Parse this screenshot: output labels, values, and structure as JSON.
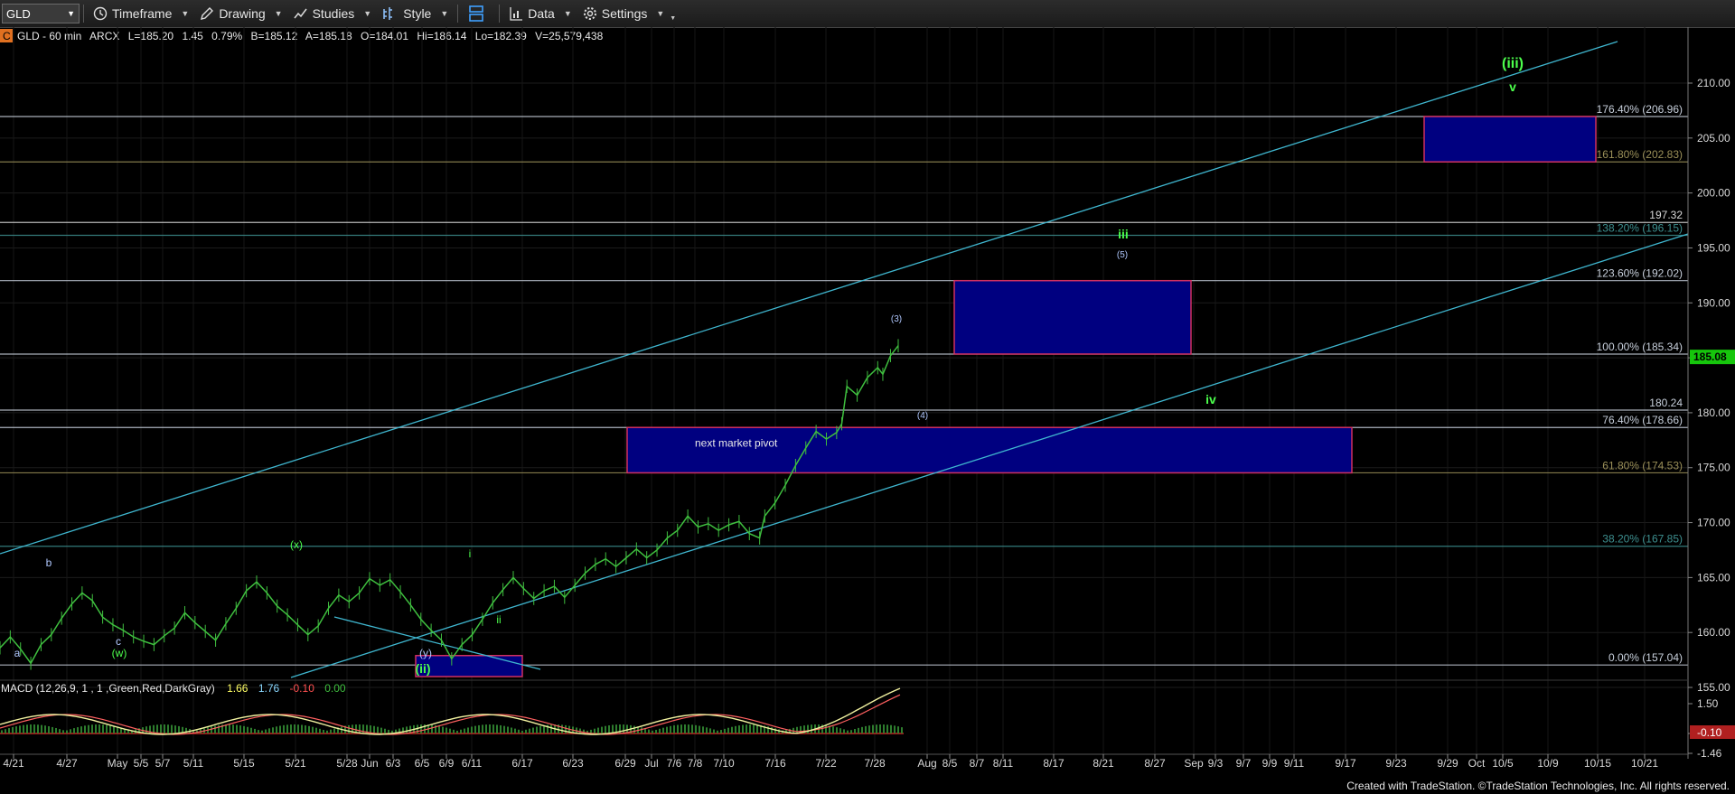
{
  "toolbar": {
    "symbol": "GLD",
    "timeframe": "Timeframe",
    "drawing": "Drawing",
    "studies": "Studies",
    "style": "Style",
    "data": "Data",
    "settings": "Settings"
  },
  "header": {
    "badge": "C",
    "fields": [
      "GLD - 60 min",
      "ARCX",
      "L=185.20",
      "1.45",
      "0.79%",
      "B=185.12",
      "A=185.18",
      "O=184.01",
      "Hi=186.14",
      "Lo=182.39",
      "V=25,579,438"
    ]
  },
  "macd_header": {
    "label": "MACD (12,26,9, 1 , 1 ,Green,Red,DarkGray)",
    "values": [
      "1.66",
      "1.76",
      "-0.10",
      "0.00"
    ],
    "colors": [
      "#ffff66",
      "#8ad8ff",
      "#ff5050",
      "#3fbf3f"
    ]
  },
  "footer": "Created with TradeStation. ©TradeStation Technologies, Inc. All rights reserved.",
  "chart_data": [
    {
      "type": "candlestick",
      "series": [
        {
          "name": "GLD",
          "description": "hourly price path (approximate)",
          "points": [
            [
              0,
              158.6
            ],
            [
              4,
              159.6
            ],
            [
              8,
              158.5
            ],
            [
              12,
              157.2
            ],
            [
              16,
              158.9
            ],
            [
              20,
              159.8
            ],
            [
              24,
              161.3
            ],
            [
              28,
              162.6
            ],
            [
              32,
              163.6
            ],
            [
              36,
              162.9
            ],
            [
              40,
              161.4
            ],
            [
              44,
              160.7
            ],
            [
              48,
              160.2
            ],
            [
              52,
              159.6
            ],
            [
              56,
              159.2
            ],
            [
              60,
              158.9
            ],
            [
              64,
              159.7
            ],
            [
              68,
              160.4
            ],
            [
              72,
              161.8
            ],
            [
              76,
              160.9
            ],
            [
              80,
              160.1
            ],
            [
              84,
              159.3
            ],
            [
              88,
              160.8
            ],
            [
              92,
              162.2
            ],
            [
              96,
              163.8
            ],
            [
              100,
              164.6
            ],
            [
              104,
              163.6
            ],
            [
              108,
              162.4
            ],
            [
              112,
              161.6
            ],
            [
              116,
              160.7
            ],
            [
              120,
              159.8
            ],
            [
              124,
              160.6
            ],
            [
              128,
              162.2
            ],
            [
              132,
              163.4
            ],
            [
              136,
              162.8
            ],
            [
              140,
              163.6
            ],
            [
              144,
              164.9
            ],
            [
              148,
              164.3
            ],
            [
              152,
              164.8
            ],
            [
              156,
              163.7
            ],
            [
              160,
              162.5
            ],
            [
              164,
              161.2
            ],
            [
              168,
              160.2
            ],
            [
              172,
              159.3
            ],
            [
              176,
              157.6
            ],
            [
              180,
              158.9
            ],
            [
              184,
              159.8
            ],
            [
              188,
              161.2
            ],
            [
              192,
              162.7
            ],
            [
              196,
              163.9
            ],
            [
              200,
              165.0
            ],
            [
              204,
              164.0
            ],
            [
              208,
              163.1
            ],
            [
              212,
              163.8
            ],
            [
              216,
              164.2
            ],
            [
              220,
              163.2
            ],
            [
              224,
              164.3
            ],
            [
              228,
              165.4
            ],
            [
              232,
              166.2
            ],
            [
              236,
              166.7
            ],
            [
              240,
              166.0
            ],
            [
              244,
              166.8
            ],
            [
              248,
              167.6
            ],
            [
              252,
              166.8
            ],
            [
              256,
              167.5
            ],
            [
              260,
              168.6
            ],
            [
              264,
              169.3
            ],
            [
              268,
              170.6
            ],
            [
              272,
              169.6
            ],
            [
              276,
              169.9
            ],
            [
              280,
              169.3
            ],
            [
              284,
              169.8
            ],
            [
              288,
              170.1
            ],
            [
              292,
              169.0
            ],
            [
              296,
              168.6
            ],
            [
              298,
              170.6
            ],
            [
              302,
              171.8
            ],
            [
              306,
              173.4
            ],
            [
              310,
              175.2
            ],
            [
              314,
              176.8
            ],
            [
              318,
              178.3
            ],
            [
              322,
              177.6
            ],
            [
              326,
              178.2
            ],
            [
              328,
              179.0
            ],
            [
              330,
              182.4
            ],
            [
              334,
              181.6
            ],
            [
              338,
              183.2
            ],
            [
              342,
              184.1
            ],
            [
              344,
              183.5
            ],
            [
              347,
              185.2
            ],
            [
              350,
              186.1
            ]
          ]
        }
      ],
      "x_tick_labels": [
        "4/21",
        "4/27",
        "May",
        "5/5",
        "5/7",
        "5/11",
        "5/15",
        "5/21",
        "5/28",
        "Jun",
        "6/3",
        "6/5",
        "6/9",
        "6/11",
        "6/17",
        "6/23",
        "6/29",
        "Jul",
        "7/6",
        "7/8",
        "7/10",
        "7/16",
        "7/22",
        "7/28",
        "Aug",
        "8/5",
        "8/7",
        "8/11",
        "8/17",
        "8/21",
        "8/27",
        "Sep",
        "9/3",
        "9/7",
        "9/9",
        "9/11",
        "9/17",
        "9/23",
        "9/29",
        "Oct",
        "10/5",
        "10/9",
        "10/15",
        "10/21"
      ],
      "ylim": [
        153.2,
        214
      ],
      "y_ticks": [
        155,
        160,
        165,
        170,
        175,
        180,
        185,
        190,
        195,
        200,
        205,
        210
      ],
      "y_tick_labels": [
        "155.00",
        "160.00",
        "165.00",
        "170.00",
        "175.00",
        "180.00",
        "185.00",
        "190.00",
        "195.00",
        "200.00",
        "205.00",
        "210.00"
      ],
      "last_price": 185.08,
      "last_price_label": "185.08",
      "fib_levels": [
        {
          "label": "176.40% (206.96)",
          "value": 206.96,
          "color": "#c8d0dc"
        },
        {
          "label": "161.80% (202.83)",
          "value": 202.83,
          "color": "#9a8f58"
        },
        {
          "label": "197.32",
          "value": 197.32,
          "color": "#d8d8d8"
        },
        {
          "label": "138.20% (196.15)",
          "value": 196.15,
          "color": "#3d8f8f"
        },
        {
          "label": "123.60% (192.02)",
          "value": 192.02,
          "color": "#c8d0dc"
        },
        {
          "label": "100.00% (185.34)",
          "value": 185.34,
          "color": "#c8d0dc"
        },
        {
          "label": "180.24",
          "value": 180.24,
          "color": "#c8d0dc"
        },
        {
          "label": "76.40% (178.66)",
          "value": 178.66,
          "color": "#c8d0dc"
        },
        {
          "label": "61.80% (174.53)",
          "value": 174.53,
          "color": "#9a8f58"
        },
        {
          "label": "38.20% (167.85)",
          "value": 167.85,
          "color": "#3d8f8f"
        },
        {
          "label": "0.00% (157.04)",
          "value": 157.04,
          "color": "#c8d0dc"
        }
      ],
      "boxes": [
        {
          "label": "next market pivot",
          "y_top": 178.66,
          "y_bottom": 174.53
        },
        {
          "label": "",
          "y_top": 192.02,
          "y_bottom": 185.34
        },
        {
          "label": "",
          "y_top": 206.96,
          "y_bottom": 202.83
        },
        {
          "label": "",
          "y_top": 157.9,
          "y_bottom": 153.2
        }
      ],
      "wave_labels": [
        {
          "text": "(iii)",
          "color": "#4cff4c"
        },
        {
          "text": "v",
          "color": "#4cff4c"
        },
        {
          "text": "iii",
          "color": "#4cff4c"
        },
        {
          "text": "(5)",
          "color": "#b0c8ff"
        },
        {
          "text": "(3)",
          "color": "#b0c8ff"
        },
        {
          "text": "(4)",
          "color": "#b0c8ff"
        },
        {
          "text": "iv",
          "color": "#4cff4c"
        },
        {
          "text": "(x)",
          "color": "#4cff4c"
        },
        {
          "text": "b",
          "color": "#b0c8ff"
        },
        {
          "text": "c",
          "color": "#b0c8ff"
        },
        {
          "text": "(w)",
          "color": "#4cff4c"
        },
        {
          "text": "a",
          "color": "#b0c8ff"
        },
        {
          "text": "i",
          "color": "#4cff4c"
        },
        {
          "text": "ii",
          "color": "#4cff4c"
        },
        {
          "text": "(y)",
          "color": "#b0c8ff"
        },
        {
          "text": "(ii)",
          "color": "#4cff4c"
        }
      ],
      "macd": {
        "y_tick_labels": [
          "1.50",
          "0.00",
          "-1.46"
        ],
        "right_value_label": "-0.10"
      }
    }
  ]
}
